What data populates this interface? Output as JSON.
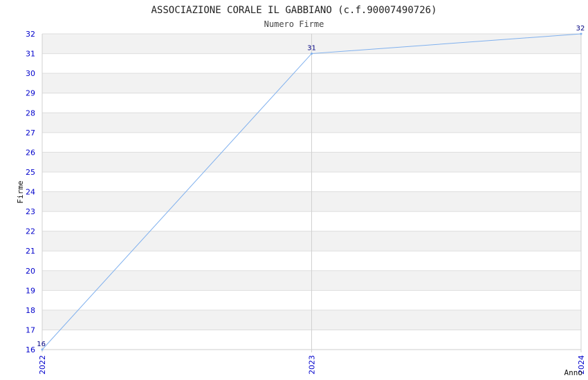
{
  "chart_data": {
    "type": "line",
    "title": "ASSOCIAZIONE CORALE IL GABBIANO (c.f.90007490726)",
    "subtitle": "Numero Firme",
    "xlabel": "Anno",
    "ylabel": "Firme",
    "categories": [
      "2022",
      "2023",
      "2024"
    ],
    "series": [
      {
        "values": [
          16,
          31,
          32
        ]
      }
    ],
    "data_labels": [
      "16",
      "31",
      "32"
    ],
    "ylim": [
      16,
      32
    ],
    "y_ticks": [
      "16",
      "17",
      "18",
      "19",
      "20",
      "21",
      "22",
      "23",
      "24",
      "25",
      "26",
      "27",
      "28",
      "29",
      "30",
      "31",
      "32"
    ],
    "grid": true,
    "colors": {
      "line": "#7fb0ee",
      "band": "#f2f2f2",
      "tick_text": "#0000cc",
      "grid": "#dddddd"
    }
  }
}
